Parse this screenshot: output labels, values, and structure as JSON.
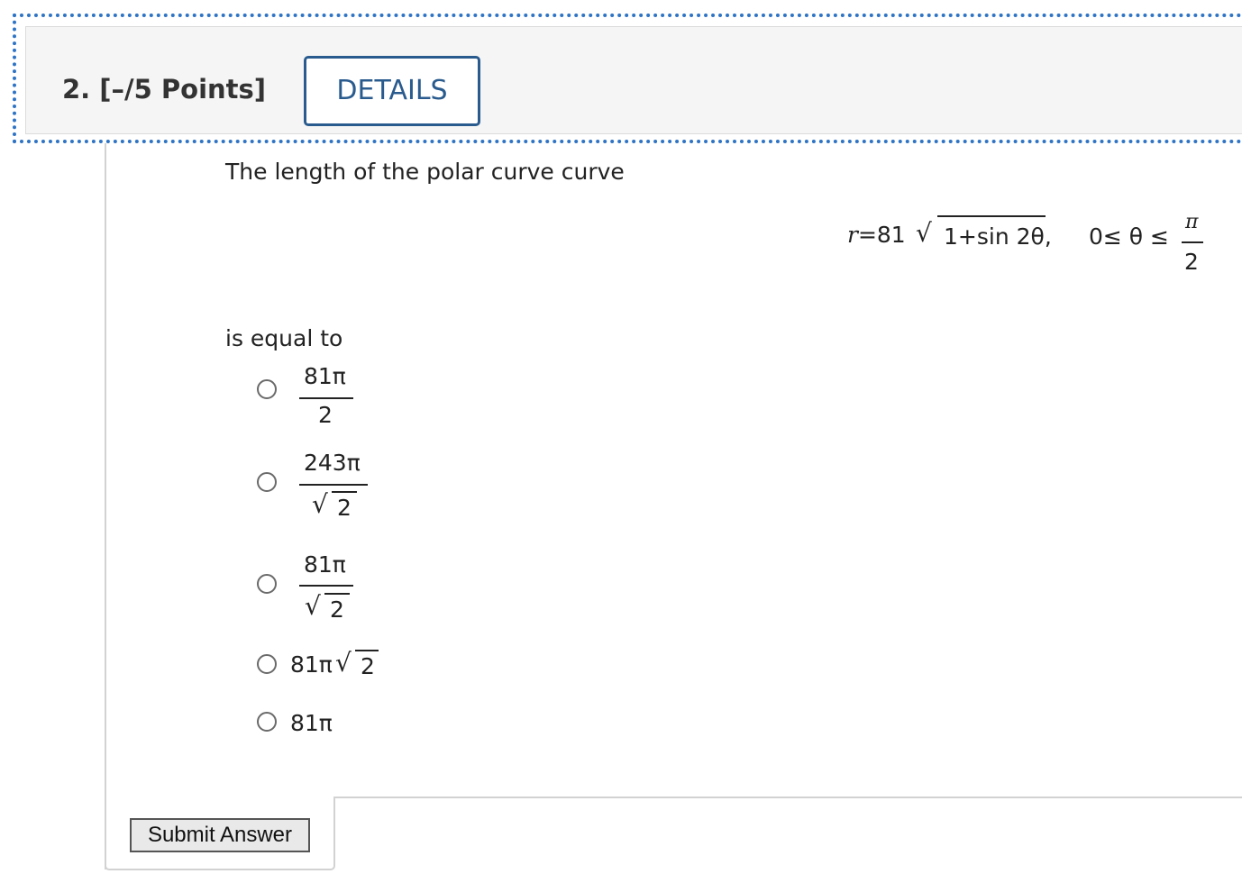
{
  "header": {
    "question_label": "2.  [–/5 Points]",
    "details_label": "DETAILS"
  },
  "question": {
    "prompt": "The length of the polar curve curve",
    "formula": {
      "r_lhs": "r",
      "r_eq": "=81",
      "radicand": "1+sin 2θ,",
      "range_start": "0≤ θ ≤",
      "range_num": "π",
      "range_den": "2"
    },
    "equal_to": "is equal to"
  },
  "options": [
    {
      "numerator": "81π",
      "denominator": "2"
    },
    {
      "numerator": "243π",
      "denominator_radicand": "2"
    },
    {
      "numerator": "81π",
      "denominator_radicand": "2"
    },
    {
      "prefix": "81π",
      "radicand": "2"
    },
    {
      "text": "81π"
    }
  ],
  "submit": {
    "label": "Submit Answer"
  }
}
